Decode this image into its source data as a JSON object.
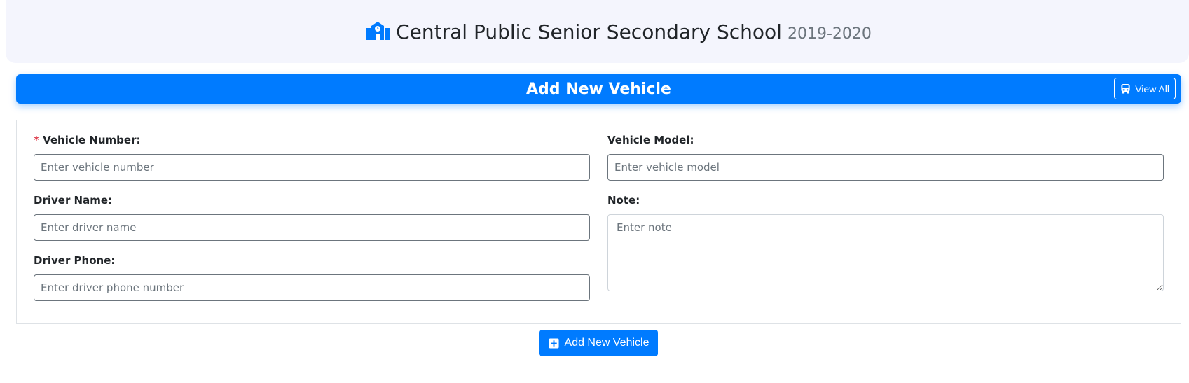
{
  "header": {
    "school_name": "Central Public Senior Secondary School",
    "session": "2019-2020",
    "icon": "school-icon"
  },
  "title_bar": {
    "title": "Add New Vehicle",
    "view_all_label": "View All",
    "view_all_icon": "bus-icon",
    "color": "#007bff"
  },
  "form": {
    "vehicle_number": {
      "label": "Vehicle Number:",
      "required_mark": "*",
      "placeholder": "Enter vehicle number",
      "value": ""
    },
    "vehicle_model": {
      "label": "Vehicle Model:",
      "placeholder": "Enter vehicle model",
      "value": ""
    },
    "driver_name": {
      "label": "Driver Name:",
      "placeholder": "Enter driver name",
      "value": ""
    },
    "note": {
      "label": "Note:",
      "placeholder": "Enter note",
      "value": ""
    },
    "driver_phone": {
      "label": "Driver Phone:",
      "placeholder": "Enter driver phone number",
      "value": ""
    }
  },
  "submit": {
    "label": "Add New Vehicle",
    "icon": "plus-square-icon"
  }
}
